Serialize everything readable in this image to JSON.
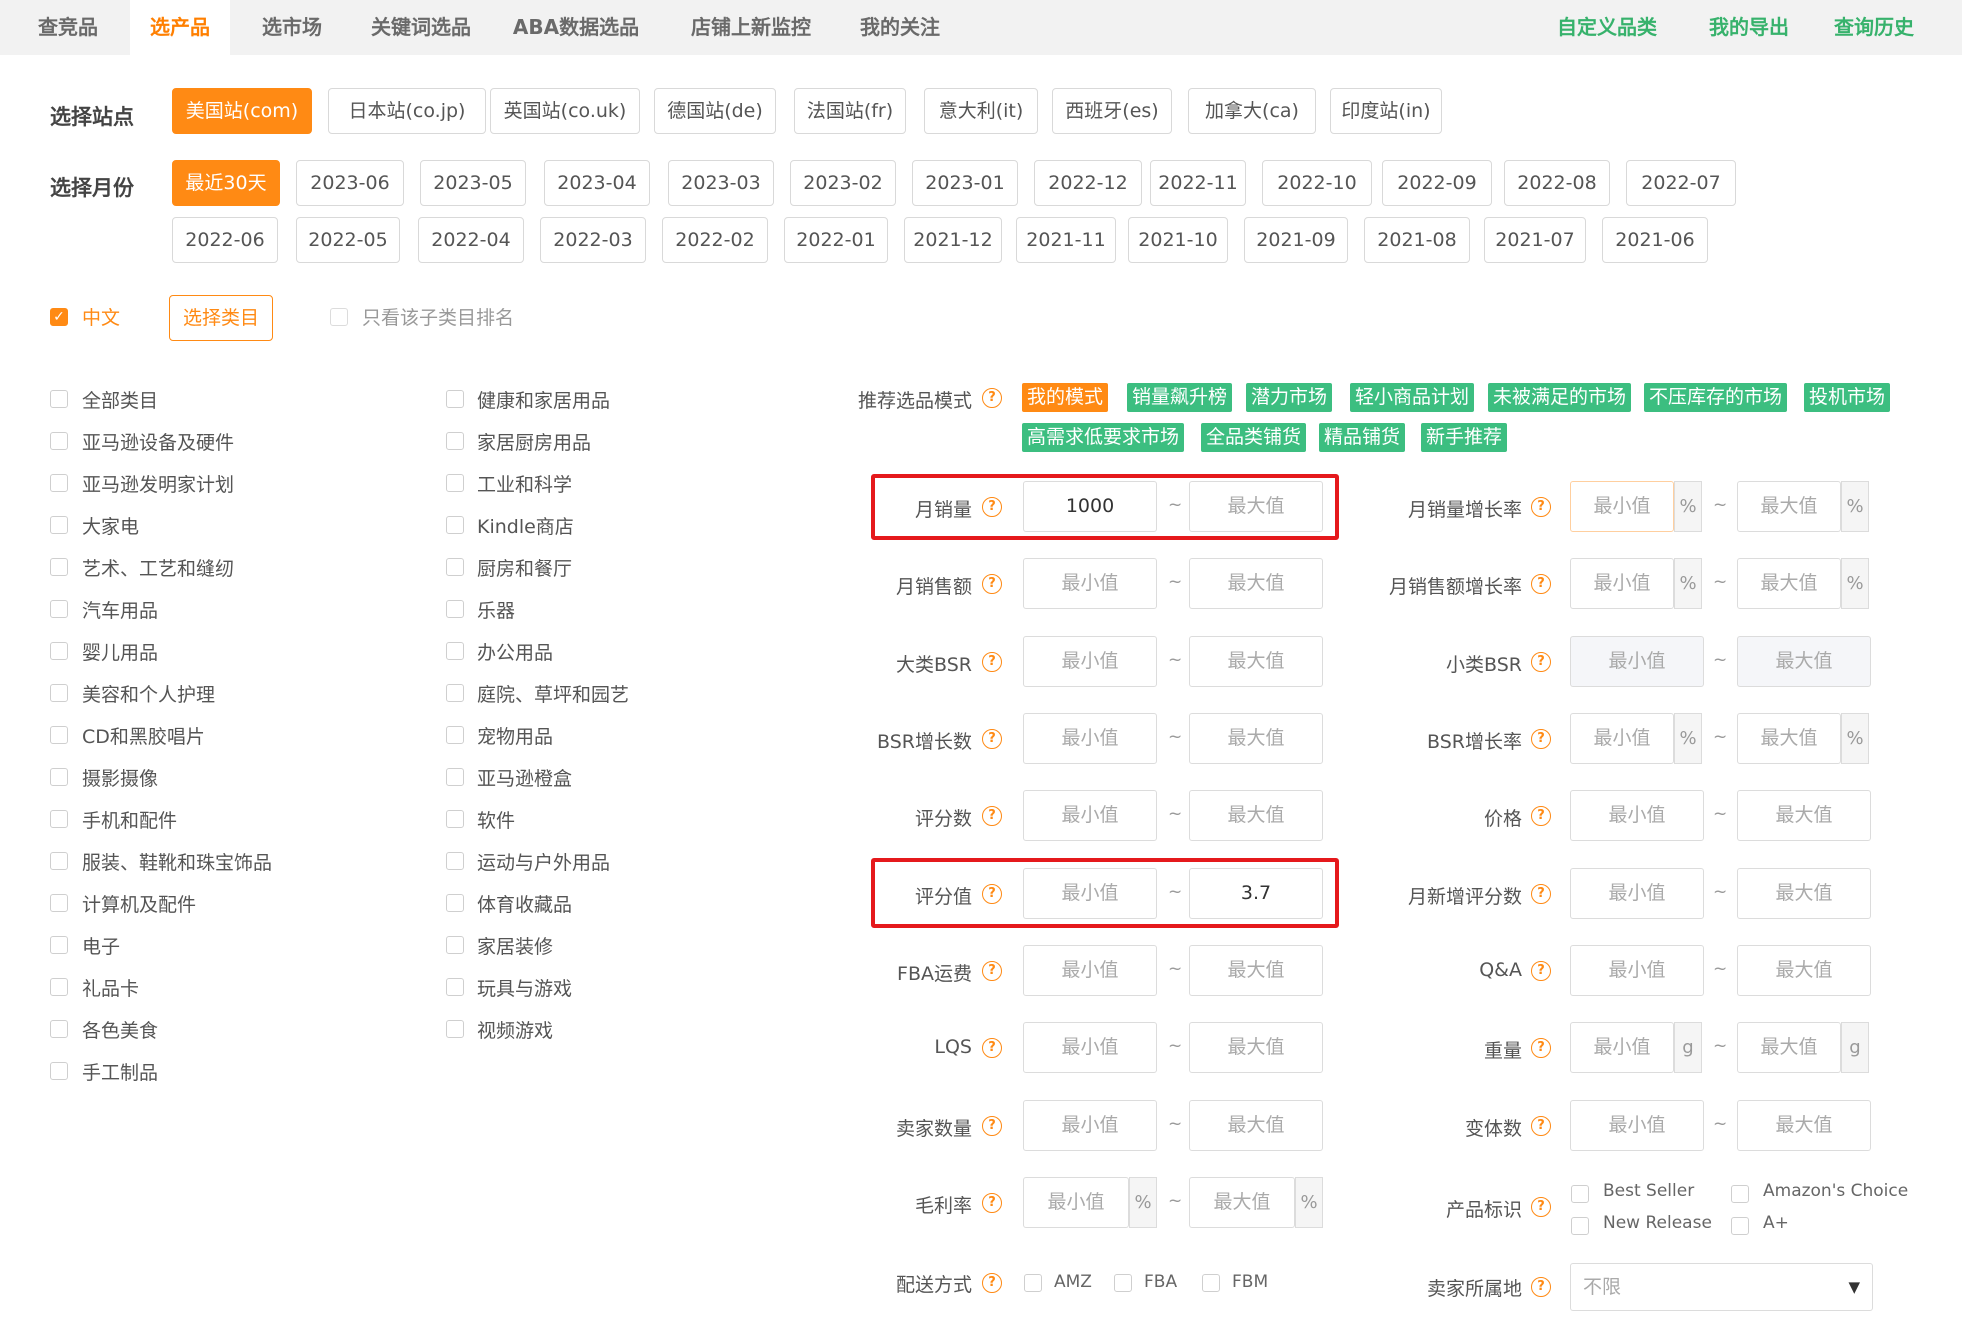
{
  "nav": {
    "tabs": [
      "查竞品",
      "选产品",
      "选市场",
      "关键词选品",
      "ABA数据选品",
      "店铺上新监控",
      "我的关注"
    ],
    "active_index": 1,
    "right_links": [
      "自定义品类",
      "我的导出",
      "查询历史"
    ]
  },
  "station": {
    "label": "选择站点",
    "options": [
      "美国站(com)",
      "日本站(co.jp)",
      "英国站(co.uk)",
      "德国站(de)",
      "法国站(fr)",
      "意大利(it)",
      "西班牙(es)",
      "加拿大(ca)",
      "印度站(in)"
    ],
    "selected_index": 0
  },
  "month": {
    "label": "选择月份",
    "row1": [
      "最近30天",
      "2023-06",
      "2023-05",
      "2023-04",
      "2023-03",
      "2023-02",
      "2023-01",
      "2022-12",
      "2022-11",
      "2022-10",
      "2022-09",
      "2022-08",
      "2022-07"
    ],
    "row2": [
      "2022-06",
      "2022-05",
      "2022-04",
      "2022-03",
      "2022-02",
      "2022-01",
      "2021-12",
      "2021-11",
      "2021-10",
      "2021-09",
      "2021-08",
      "2021-07",
      "2021-06"
    ],
    "selected": "最近30天"
  },
  "category_bar": {
    "chinese_label": "中文",
    "chinese_checked": true,
    "select_button": "选择类目",
    "subcat_only_label": "只看该子类目排名"
  },
  "categories_left": [
    "全部类目",
    "亚马逊设备及硬件",
    "亚马逊发明家计划",
    "大家电",
    "艺术、工艺和缝纫",
    "汽车用品",
    "婴儿用品",
    "美容和个人护理",
    "CD和黑胶唱片",
    "摄影摄像",
    "手机和配件",
    "服装、鞋靴和珠宝饰品",
    "计算机及配件",
    "电子",
    "礼品卡",
    "各色美食",
    "手工制品"
  ],
  "categories_right": [
    "健康和家居用品",
    "家居厨房用品",
    "工业和科学",
    "Kindle商店",
    "厨房和餐厅",
    "乐器",
    "办公用品",
    "庭院、草坪和园艺",
    "宠物用品",
    "亚马逊橙盒",
    "软件",
    "运动与户外用品",
    "体育收藏品",
    "家居装修",
    "玩具与游戏",
    "视频游戏"
  ],
  "modes": {
    "label": "推荐选品模式",
    "row1": [
      "我的模式",
      "销量飙升榜",
      "潜力市场",
      "轻小商品计划",
      "未被满足的市场",
      "不压库存的市场",
      "投机市场"
    ],
    "row2": [
      "高需求低要求市场",
      "全品类铺货",
      "精品铺货",
      "新手推荐"
    ],
    "active": "我的模式"
  },
  "placeholders": {
    "min": "最小值",
    "max": "最大值"
  },
  "filters_left": [
    {
      "label": "月销量",
      "min": "1000",
      "max": ""
    },
    {
      "label": "月销售额",
      "min": "",
      "max": ""
    },
    {
      "label": "大类BSR",
      "min": "",
      "max": ""
    },
    {
      "label": "BSR增长数",
      "min": "",
      "max": ""
    },
    {
      "label": "评分数",
      "min": "",
      "max": ""
    },
    {
      "label": "评分值",
      "min": "",
      "max": "3.7"
    },
    {
      "label": "FBA运费",
      "min": "",
      "max": ""
    },
    {
      "label": "LQS",
      "min": "",
      "max": ""
    },
    {
      "label": "卖家数量",
      "min": "",
      "max": ""
    },
    {
      "label": "毛利率",
      "min": "",
      "max": "",
      "unit": "%"
    }
  ],
  "filters_right": [
    {
      "label": "月销量增长率",
      "unit": "%"
    },
    {
      "label": "月销售额增长率",
      "unit": "%"
    },
    {
      "label": "小类BSR",
      "unit": ""
    },
    {
      "label": "BSR增长率",
      "unit": "%"
    },
    {
      "label": "价格",
      "unit": ""
    },
    {
      "label": "月新增评分数",
      "unit": ""
    },
    {
      "label": "Q&A",
      "unit": ""
    },
    {
      "label": "重量",
      "unit": "g"
    },
    {
      "label": "变体数",
      "unit": ""
    }
  ],
  "product_tags": {
    "label": "产品标识",
    "options": [
      "Best Seller",
      "Amazon's Choice",
      "New Release",
      "A+"
    ]
  },
  "delivery": {
    "label": "配送方式",
    "options": [
      "AMZ",
      "FBA",
      "FBM"
    ]
  },
  "seller_location": {
    "label": "卖家所属地",
    "value": "不限"
  },
  "colors": {
    "accent": "#ff8a14",
    "green": "#3cbe80",
    "highlight": "#e5191c"
  }
}
